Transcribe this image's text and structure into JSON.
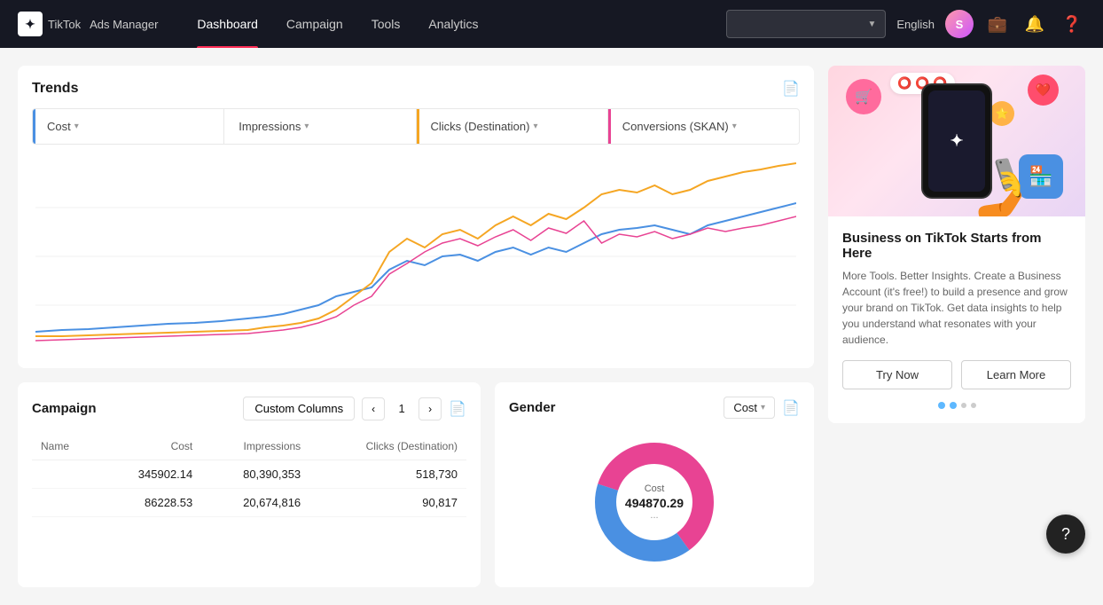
{
  "app": {
    "logo_text": "TikTok",
    "logo_sub": "Ads Manager"
  },
  "nav": {
    "links": [
      {
        "id": "dashboard",
        "label": "Dashboard",
        "active": true
      },
      {
        "id": "campaign",
        "label": "Campaign",
        "active": false
      },
      {
        "id": "tools",
        "label": "Tools",
        "active": false
      },
      {
        "id": "analytics",
        "label": "Analytics",
        "active": false
      }
    ],
    "search_placeholder": "",
    "language": "English",
    "avatar_initial": "S"
  },
  "trends": {
    "title": "Trends",
    "export_icon": "📄",
    "metrics": [
      {
        "id": "cost",
        "label": "Cost",
        "active": true,
        "color": "blue"
      },
      {
        "id": "impressions",
        "label": "Impressions",
        "active": false,
        "color": "none"
      },
      {
        "id": "clicks",
        "label": "Clicks (Destination)",
        "active": false,
        "color": "orange"
      },
      {
        "id": "conversions",
        "label": "Conversions (SKAN)",
        "active": false,
        "color": "pink"
      }
    ]
  },
  "campaign": {
    "title": "Campaign",
    "custom_columns_label": "Custom Columns",
    "page_num": "1",
    "columns": [
      "Name",
      "Cost",
      "Impressions",
      "Clicks (Destination)"
    ],
    "rows": [
      {
        "name": "",
        "cost": "345902.14",
        "impressions": "80,390,353",
        "clicks": "518,730"
      },
      {
        "name": "",
        "cost": "86228.53",
        "impressions": "20,674,816",
        "clicks": "90,817"
      }
    ]
  },
  "gender": {
    "title": "Gender",
    "cost_label": "Cost",
    "donut_center_label": "Cost",
    "donut_center_value": "494870.29",
    "donut_center_sub": "..."
  },
  "promo": {
    "title": "Business on TikTok Starts from Here",
    "desc": "More Tools. Better Insights. Create a Business Account (it's free!) to build a presence and grow your brand on TikTok. Get data insights to help you understand what resonates with your audience.",
    "btn_try": "Try Now",
    "btn_learn": "Learn More",
    "dots": [
      {
        "active": true,
        "color": "#5eb8ff"
      },
      {
        "active": true,
        "color": "#5eb8ff"
      },
      {
        "active": false,
        "color": "#ccc"
      },
      {
        "active": false,
        "color": "#ccc"
      }
    ]
  },
  "help": {
    "icon": "?"
  }
}
